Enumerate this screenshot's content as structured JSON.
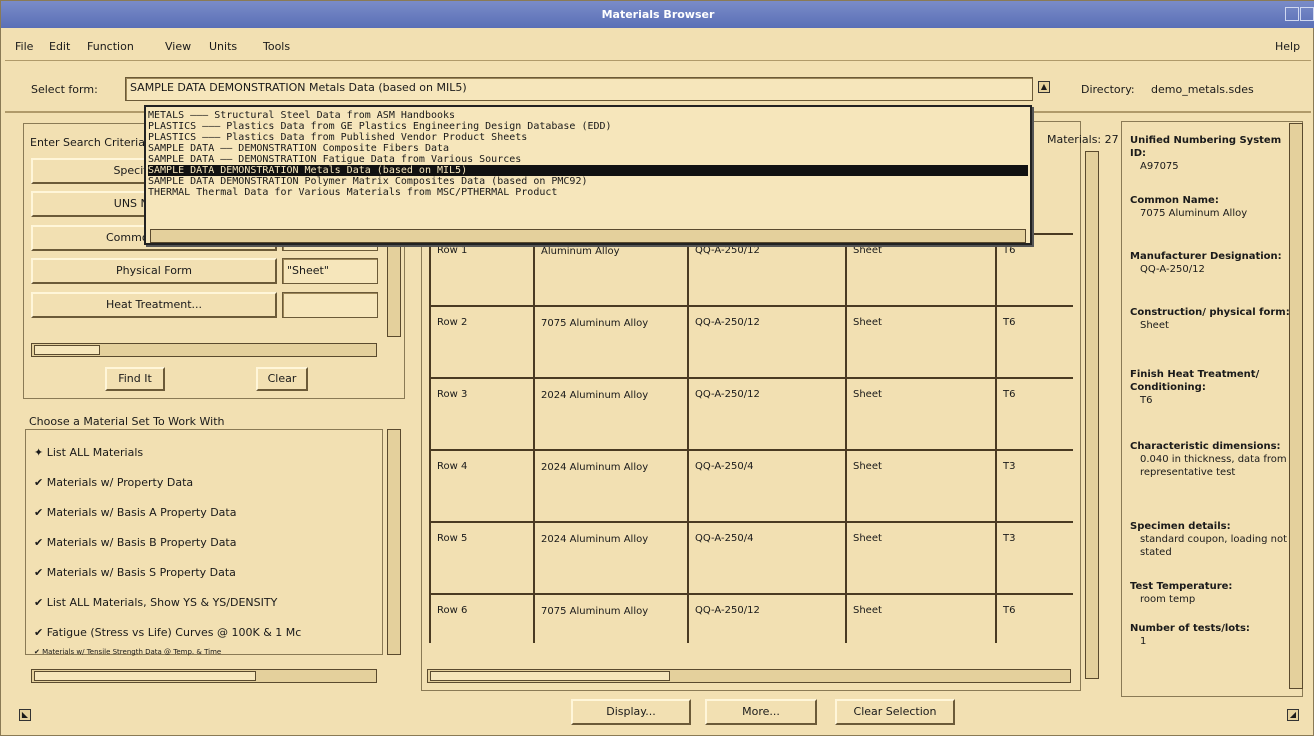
{
  "window": {
    "title": "Materials Browser"
  },
  "menu": {
    "items": [
      "File",
      "Edit",
      "Function",
      "View",
      "Units",
      "Tools"
    ],
    "help": "Help"
  },
  "select_form": {
    "label": "Select form:",
    "value": "SAMPLE DATA   DEMONSTRATION Metals Data (based on MIL5)",
    "dir_label": "Directory:",
    "dir_value": "demo_metals.sdes"
  },
  "dropdown": {
    "items": [
      "METALS ——— Structural Steel Data from ASM Handbooks",
      "PLASTICS ——— Plastics Data from GE Plastics Engineering Design Database (EDD)",
      "PLASTICS ——— Plastics Data from Published Vendor Product Sheets",
      "SAMPLE DATA —— DEMONSTRATION Composite Fibers Data",
      "SAMPLE DATA —— DEMONSTRATION Fatigue Data from Various Sources",
      "SAMPLE DATA     DEMONSTRATION Metals Data (based on MIL5)",
      "SAMPLE DATA     DEMONSTRATION Polymer Matrix Composites Data (based on PMC92)",
      "THERMAL          Thermal Data for Various Materials from MSC/PTHERMAL Product"
    ],
    "selected_index": 5
  },
  "search": {
    "label": "Enter Search Criteria",
    "buttons": [
      "Specification...",
      "UNS Number...",
      "Common Name...",
      "Physical Form",
      "Heat Treatment..."
    ],
    "values": [
      "",
      "",
      "",
      "\"Sheet\"",
      ""
    ],
    "find_label": "Find It",
    "clear_label": "Clear"
  },
  "material_set": {
    "label": "Choose a Material Set To Work With",
    "items": [
      "List ALL Materials",
      "Materials w/ Property Data",
      "Materials w/ Basis A Property Data",
      "Materials w/ Basis B Property Data",
      "Materials w/ Basis S Property Data",
      "List ALL Materials, Show YS & YS/DENSITY",
      "Fatigue (Stress vs Life) Curves @ 100K & 1 Mc",
      "Materials w/ Tensile Strength Data @ Temp. & Time"
    ]
  },
  "results": {
    "count_label": "Materials: 27",
    "rows": [
      {
        "label": "Row 1",
        "name": "Aluminum Alloy",
        "spec": "QQ-A-250/12",
        "form": "Sheet",
        "ht": "T6"
      },
      {
        "label": "Row 2",
        "name": "7075 Aluminum Alloy",
        "spec": "QQ-A-250/12",
        "form": "Sheet",
        "ht": "T6"
      },
      {
        "label": "Row 3",
        "name": "2024 Aluminum Alloy",
        "spec": "QQ-A-250/12",
        "form": "Sheet",
        "ht": "T6"
      },
      {
        "label": "Row 4",
        "name": "2024 Aluminum Alloy",
        "spec": "QQ-A-250/4",
        "form": "Sheet",
        "ht": "T3"
      },
      {
        "label": "Row 5",
        "name": "2024 Aluminum Alloy",
        "spec": "QQ-A-250/4",
        "form": "Sheet",
        "ht": "T3"
      },
      {
        "label": "Row 6",
        "name": "7075 Aluminum Alloy",
        "spec": "QQ-A-250/12",
        "form": "Sheet",
        "ht": "T6"
      }
    ]
  },
  "actions": {
    "display": "Display...",
    "more": "More...",
    "clear_selection": "Clear Selection"
  },
  "details": {
    "blocks": [
      {
        "h": "Unified Numbering System ID:",
        "v": "A97075"
      },
      {
        "h": "Common Name:",
        "v": "7075 Aluminum Alloy"
      },
      {
        "h": "Manufacturer Designation:",
        "v": "QQ-A-250/12"
      },
      {
        "h": "Construction/ physical form:",
        "v": "Sheet"
      },
      {
        "h": "Finish Heat Treatment/ Conditioning:",
        "v": "T6"
      },
      {
        "h": "Characteristic dimensions:",
        "v": "0.040 in thickness, data from representative test"
      },
      {
        "h": "Specimen details:",
        "v": "standard coupon, loading not stated"
      },
      {
        "h": "Test Temperature:",
        "v": "room temp"
      },
      {
        "h": "Number of tests/lots:",
        "v": "1"
      }
    ]
  }
}
